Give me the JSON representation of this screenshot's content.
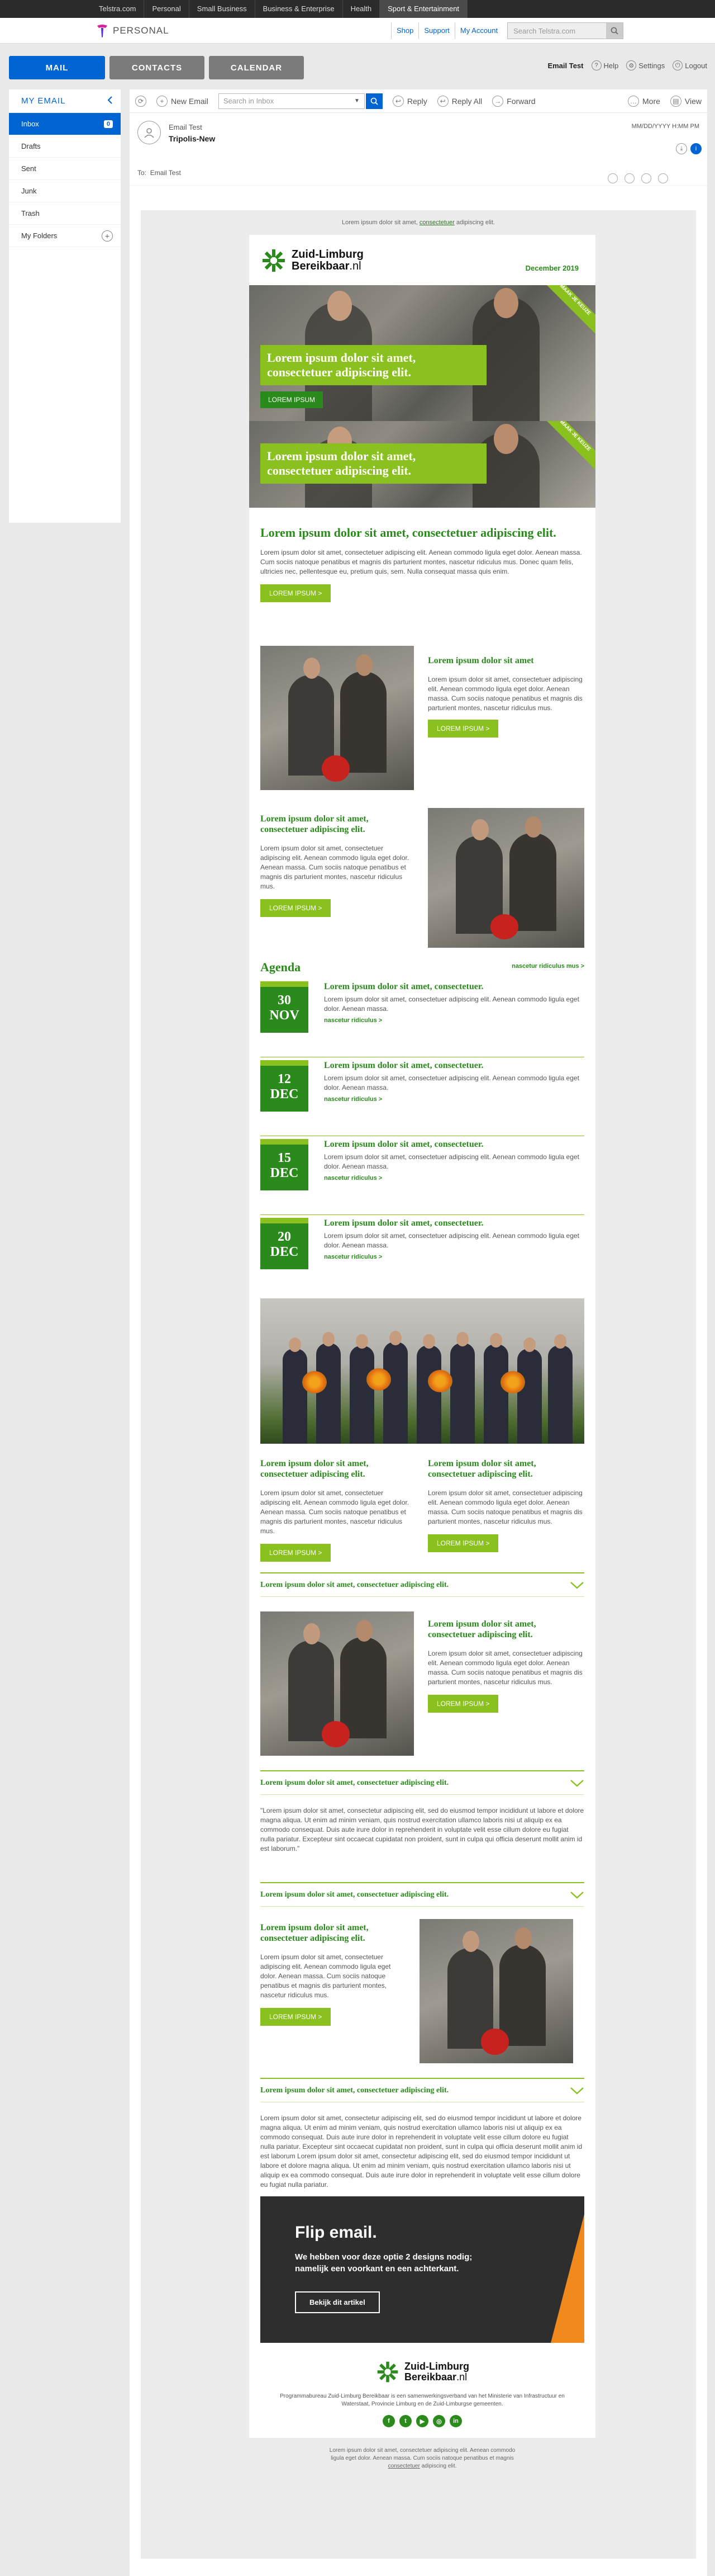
{
  "topbar": {
    "links": [
      "Telstra.com",
      "Personal",
      "Small Business",
      "Business & Enterprise",
      "Health",
      "Sport & Entertainment"
    ],
    "active_index": 5
  },
  "brand": {
    "label": "PERSONAL",
    "nav": [
      "Shop",
      "Support",
      "My Account"
    ],
    "search_placeholder": "Search Telstra.com"
  },
  "tabs": {
    "mail": "MAIL",
    "contacts": "CONTACTS",
    "calendar": "CALENDAR"
  },
  "account": {
    "name": "Email Test",
    "help": "Help",
    "settings": "Settings",
    "logout": "Logout"
  },
  "sidebar": {
    "title": "MY EMAIL",
    "items": [
      {
        "label": "Inbox",
        "badge": "0"
      },
      {
        "label": "Drafts"
      },
      {
        "label": "Sent"
      },
      {
        "label": "Junk"
      },
      {
        "label": "Trash"
      },
      {
        "label": "My Folders"
      }
    ]
  },
  "toolbar": {
    "new_email": "New Email",
    "search_placeholder": "Search in Inbox",
    "reply": "Reply",
    "reply_all": "Reply All",
    "forward": "Forward",
    "more": "More",
    "view": "View"
  },
  "message": {
    "from": "Email Test",
    "subject": "Tripolis-New",
    "to_label": "To:",
    "to": "Email Test",
    "date": "MM/DD/YYYY H:MM PM"
  },
  "newsletter": {
    "preheader": "Lorem ipsum dolor sit amet,",
    "preheader_link": "consectetuer",
    "preheader_tail": "adipiscing elit.",
    "logo_line1": "Zuid-Limburg",
    "logo_line2a": "Bereikbaar",
    "logo_line2b": ".nl",
    "month": "December 2019",
    "hero1": {
      "caption": "Lorem ipsum dolor sit amet, consectetuer adipiscing elit.",
      "cta": "LOREM IPSUM",
      "ribbon": "MAAK JE KEUZE"
    },
    "hero2": {
      "caption": "Lorem ipsum dolor sit amet, consectetuer adipiscing elit.",
      "ribbon": "MAAK JE KEUZE"
    },
    "intro": {
      "title": "Lorem ipsum dolor sit amet, consectetuer adipiscing elit.",
      "text": "Lorem ipsum dolor sit amet, consectetuer adipiscing elit. Aenean commodo ligula eget dolor. Aenean massa. Cum sociis natoque penatibus et magnis dis parturient montes, nascetur ridiculus mus. Donec quam felis, ultricies nec, pellentesque eu, pretium quis, sem. Nulla consequat massa quis enim.",
      "button": "LOREM IPSUM >"
    },
    "feature1": {
      "title": "Lorem ipsum dolor sit amet",
      "text": "Lorem ipsum dolor sit amet, consectetuer adipiscing elit. Aenean commodo ligula eget dolor. Aenean massa. Cum sociis natoque penatibus et magnis dis parturient montes, nascetur ridiculus mus.",
      "button": "LOREM IPSUM >"
    },
    "feature2": {
      "title": "Lorem ipsum dolor sit amet, consectetuer adipiscing elit.",
      "text": "Lorem ipsum dolor sit amet, consectetuer adipiscing elit. Aenean commodo ligula eget dolor. Aenean massa. Cum sociis natoque penatibus et magnis dis parturient montes, nascetur ridiculus mus.",
      "button": "LOREM IPSUM >"
    },
    "agenda": {
      "title": "Agenda",
      "more": "nascetur ridiculus mus >",
      "items": [
        {
          "day": "30",
          "month": "NOV",
          "title": "Lorem ipsum dolor sit amet, consectetuer.",
          "text": "Lorem ipsum dolor sit amet, consectetuer adipiscing elit. Aenean commodo ligula eget dolor. Aenean massa.",
          "link": "nascetur ridiculus >"
        },
        {
          "day": "12",
          "month": "DEC",
          "title": "Lorem ipsum dolor sit amet, consectetuer.",
          "text": "Lorem ipsum dolor sit amet, consectetuer adipiscing elit. Aenean commodo ligula eget dolor. Aenean massa.",
          "link": "nascetur ridiculus >"
        },
        {
          "day": "15",
          "month": "DEC",
          "title": "Lorem ipsum dolor sit amet, consectetuer.",
          "text": "Lorem ipsum dolor sit amet, consectetuer adipiscing elit. Aenean commodo ligula eget dolor. Aenean massa.",
          "link": "nascetur ridiculus >"
        },
        {
          "day": "20",
          "month": "DEC",
          "title": "Lorem ipsum dolor sit amet, consectetuer.",
          "text": "Lorem ipsum dolor sit amet, consectetuer adipiscing elit. Aenean commodo ligula eget dolor. Aenean massa.",
          "link": "nascetur ridiculus >"
        }
      ]
    },
    "twocol": [
      {
        "title": "Lorem ipsum dolor sit amet, consectetuer adipiscing elit.",
        "text": "Lorem ipsum dolor sit amet, consectetuer adipiscing elit. Aenean commodo ligula eget dolor. Aenean massa. Cum sociis natoque penatibus et magnis dis parturient montes, nascetur ridiculus mus.",
        "button": "LOREM IPSUM >"
      },
      {
        "title": "Lorem ipsum dolor sit amet, consectetuer adipiscing elit.",
        "text": "Lorem ipsum dolor sit amet, consectetuer adipiscing elit. Aenean commodo ligula eget dolor. Aenean massa. Cum sociis natoque penatibus et magnis dis parturient montes, nascetur ridiculus mus.",
        "button": "LOREM IPSUM >"
      }
    ],
    "acc1": {
      "title": "Lorem ipsum dolor sit amet, consectetuer adipiscing elit."
    },
    "feature3": {
      "title": "Lorem ipsum dolor sit amet, consectetuer adipiscing elit.",
      "text": "Lorem ipsum dolor sit amet, consectetuer adipiscing elit. Aenean commodo ligula eget dolor. Aenean massa. Cum sociis natoque penatibus et magnis dis parturient montes, nascetur ridiculus mus.",
      "button": "LOREM IPSUM >"
    },
    "acc2": {
      "title": "Lorem ipsum dolor sit amet, consectetuer adipiscing elit."
    },
    "quote": "\"Lorem ipsum dolor sit amet, consectetur adipiscing elit, sed do eiusmod tempor incididunt ut labore et dolore magna aliqua. Ut enim ad minim veniam, quis nostrud exercitation ullamco laboris nisi ut aliquip ex ea commodo consequat. Duis aute irure dolor in reprehenderit in voluptate velit esse cillum dolore eu fugiat nulla pariatur. Excepteur sint occaecat cupidatat non proident, sunt in culpa qui officia deserunt mollit anim id est laborum.\"",
    "acc3": {
      "title": "Lorem ipsum dolor sit amet, consectetuer adipiscing elit."
    },
    "feature4": {
      "title": "Lorem ipsum dolor sit amet, consectetuer adipiscing elit.",
      "text": "Lorem ipsum dolor sit amet, consectetuer adipiscing elit. Aenean commodo ligula eget dolor. Aenean massa. Cum sociis natoque penatibus et magnis dis parturient montes, nascetur ridiculus mus.",
      "button": "LOREM IPSUM >"
    },
    "acc4": {
      "title": "Lorem ipsum dolor sit amet, consectetuer adipiscing elit."
    },
    "longtext": "Lorem ipsum dolor sit amet, consectetur adipiscing elit, sed do eiusmod tempor incididunt ut labore et dolore magna aliqua. Ut enim ad minim veniam, quis nostrud exercitation ullamco laboris nisi ut aliquip ex ea commodo consequat. Duis aute irure dolor in reprehenderit in voluptate velit esse cillum dolore eu fugiat nulla pariatur. Excepteur sint occaecat cupidatat non proident, sunt in culpa qui officia deserunt mollit anim id est laborum Lorem ipsum dolor sit amet, consectetur adipiscing elit, sed do eiusmod tempor incididunt ut labore et dolore magna aliqua. Ut enim ad minim veniam, quis nostrud exercitation ullamco laboris nisi ut aliquip ex ea commodo consequat. Duis aute irure dolor in reprehenderit in voluptate velit esse cillum dolore eu fugiat nulla pariatur.",
    "flip": {
      "title": "Flip email.",
      "text": "We hebben voor deze optie 2 designs nodig; namelijk een voorkant en een achterkant.",
      "button": "Bekijk dit artikel"
    },
    "footer": {
      "text": "Programmabureau Zuid-Limburg Bereikbaar is een samenwerkingsverband van het Ministerie van Infrastructuur en Waterstaat, Provincie Limburg en de Zuid-Limburgse gemeenten.",
      "bottom1": "Lorem ipsum dolor sit amet, consectetuer adipiscing elit. Aenean commodo",
      "bottom2": "ligula eget dolor. Aenean massa. Cum sociis natoque penatibus et magnis",
      "bottom3_link": "consectetuer",
      "bottom3_tail": "adipiscing elit."
    },
    "colors": {
      "green": "#2a8a1b",
      "lime": "#8ac11e",
      "orange": "#f08a1c"
    }
  }
}
